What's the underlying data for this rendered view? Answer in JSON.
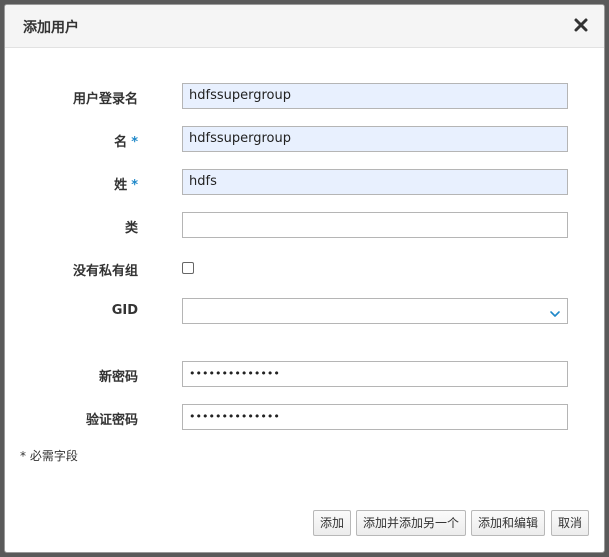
{
  "dialog": {
    "title": "添加用户",
    "close_icon": "close-icon"
  },
  "form": {
    "login": {
      "label": "用户登录名",
      "value": "hdfssupergroup"
    },
    "first_name": {
      "label": "名",
      "value": "hdfssupergroup",
      "required_mark": "*"
    },
    "last_name": {
      "label": "姓",
      "value": "hdfs",
      "required_mark": "*"
    },
    "class": {
      "label": "类",
      "value": ""
    },
    "no_private_group": {
      "label": "没有私有组",
      "checked": false
    },
    "gid": {
      "label": "GID",
      "value": "",
      "chevron_icon": "chevron-down-icon"
    },
    "password": {
      "label": "新密码",
      "value": "••••••••••••••"
    },
    "verify_password": {
      "label": "验证密码",
      "value": "••••••••••••••"
    },
    "required_note": "* 必需字段"
  },
  "buttons": {
    "add": "添加",
    "add_and_add_another": "添加并添加另一个",
    "add_and_edit": "添加和编辑",
    "cancel": "取消"
  },
  "colors": {
    "accent": "#1f88c9",
    "autofill_bg": "#e8f0fe"
  }
}
